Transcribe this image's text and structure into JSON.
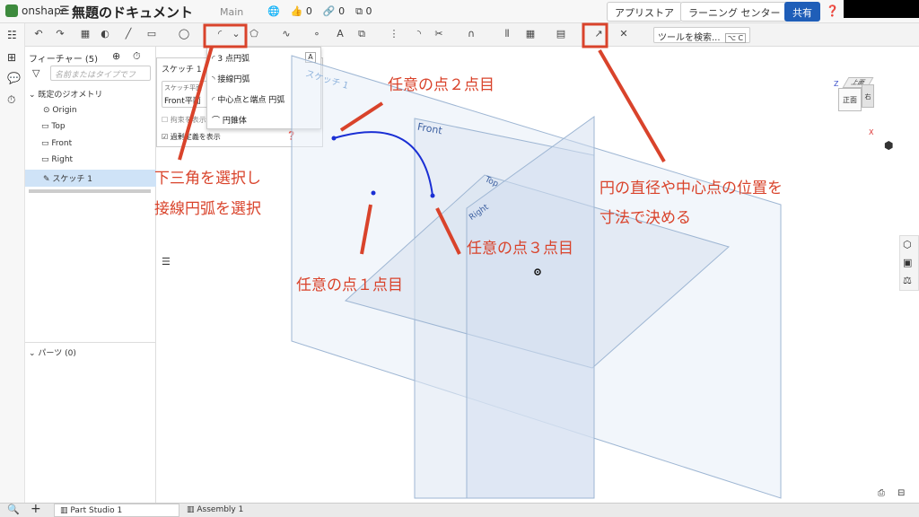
{
  "app": {
    "name": "onshape",
    "doc_title": "無題のドキュメント",
    "branch": "Main",
    "stats": [
      "0",
      "0",
      "0"
    ]
  },
  "header_buttons": {
    "app_store": "アプリストア",
    "learning": "ラーニング センター",
    "share": "共有"
  },
  "toolbar": {
    "search_tools": "ツールを検索...",
    "shortcut": "⌥ C"
  },
  "feature_panel": {
    "title": "フィーチャー (5)",
    "filter_placeholder": "名前またはタイプでフ",
    "default_geometry": "既定のジオメトリ",
    "items": [
      "Origin",
      "Top",
      "Front",
      "Right"
    ],
    "sketch": "スケッチ 1",
    "parts": "パーツ (0)"
  },
  "sketch_panel": {
    "title": "スケッチ 1",
    "plane_label": "スケッチ平面",
    "plane_value": "Front平面",
    "option1": "拘束を表示",
    "option2": "過剰定義を表示"
  },
  "arc_menu": {
    "items": [
      "3 点円弧",
      "接線円弧",
      "中心点と端点 円弧",
      "円錐体"
    ],
    "shortcut": "A"
  },
  "viewport": {
    "plane_labels": [
      "Front",
      "Top",
      "Right"
    ],
    "sketch_label": "スケッチ 1",
    "cube_faces": [
      "上面",
      "正面",
      "右"
    ],
    "axes": [
      "Z",
      "X"
    ]
  },
  "annotations": {
    "dropdown_select_1": "下三角を選択し",
    "dropdown_select_2": "接線円弧を選択",
    "point1": "任意の点１点目",
    "point2": "任意の点２点目",
    "point3": "任意の点３点目",
    "dimension_1": "円の直径や中心点の位置を",
    "dimension_2": "寸法で決める"
  },
  "tabs": [
    "Part Studio 1",
    "Assembly 1"
  ],
  "colors": {
    "annotation": "#d9432b",
    "arc": "#1a2fd4",
    "share": "#1f5eb8",
    "selection": "#cfe3f7"
  }
}
